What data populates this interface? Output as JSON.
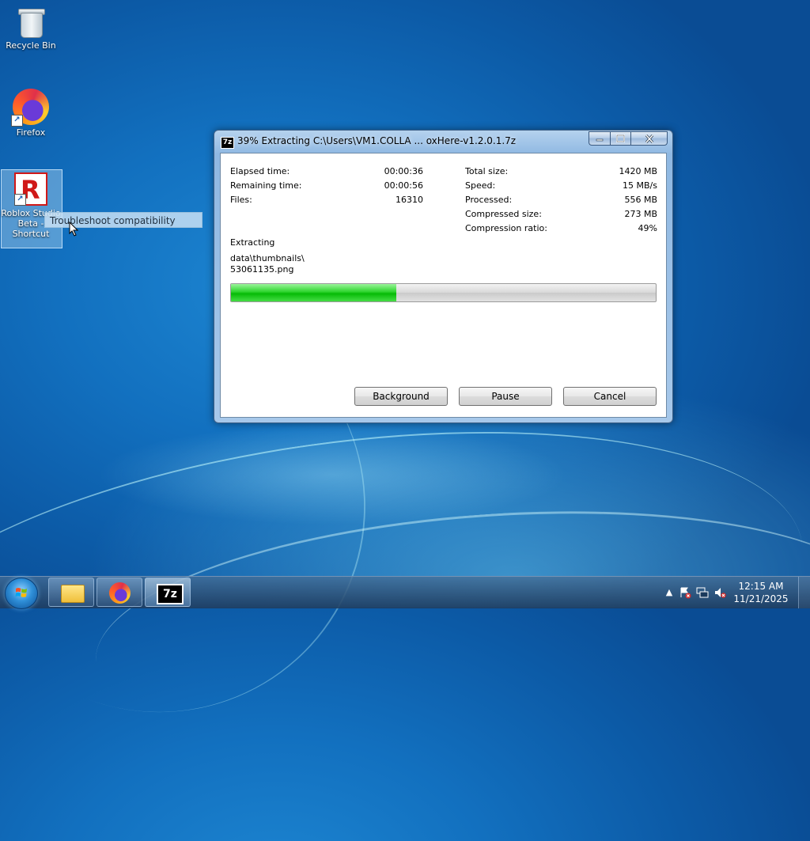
{
  "desktop": {
    "icons": [
      {
        "label": "Recycle Bin",
        "icon": "recycle-bin-icon"
      },
      {
        "label": "Firefox",
        "icon": "firefox-icon"
      },
      {
        "label_lines": [
          "Roblox Studio",
          "Beta -",
          "Shortcut"
        ],
        "icon": "roblox-icon"
      }
    ],
    "drag_tooltip": "Troubleshoot compatibility"
  },
  "dialog": {
    "app_icon_text": "7z",
    "title": "39% Extracting C:\\Users\\VM1.COLLA ... oxHere-v1.2.0.1.7z",
    "left_stats": [
      {
        "label": "Elapsed time:",
        "value": "00:00:36"
      },
      {
        "label": "Remaining time:",
        "value": "00:00:56"
      },
      {
        "label": "Files:",
        "value": "16310"
      }
    ],
    "right_stats": [
      {
        "label": "Total size:",
        "value": "1420 MB"
      },
      {
        "label": "Speed:",
        "value": "15 MB/s"
      },
      {
        "label": "Processed:",
        "value": "556 MB"
      },
      {
        "label": "Compressed size:",
        "value": "273 MB"
      },
      {
        "label": "Compression ratio:",
        "value": "49%"
      }
    ],
    "status_label": "Extracting",
    "current_file_dir": "data\\thumbnails\\",
    "current_file_name": "53061135.png",
    "progress_fraction": 0.39,
    "buttons": {
      "background": "Background",
      "pause": "Pause",
      "cancel": "Cancel"
    }
  },
  "taskbar": {
    "pinned": [
      {
        "name": "file-explorer",
        "icon": "folder-icon"
      },
      {
        "name": "firefox",
        "icon": "firefox-icon"
      },
      {
        "name": "7-zip",
        "icon": "7zip-icon",
        "icon_text": "7z",
        "active": true
      }
    ],
    "clock": {
      "time": "12:15 AM",
      "date": "11/21/2025"
    }
  },
  "colors": {
    "progress_fill": "#06bb06",
    "desktop_bg": "#1270bf"
  }
}
